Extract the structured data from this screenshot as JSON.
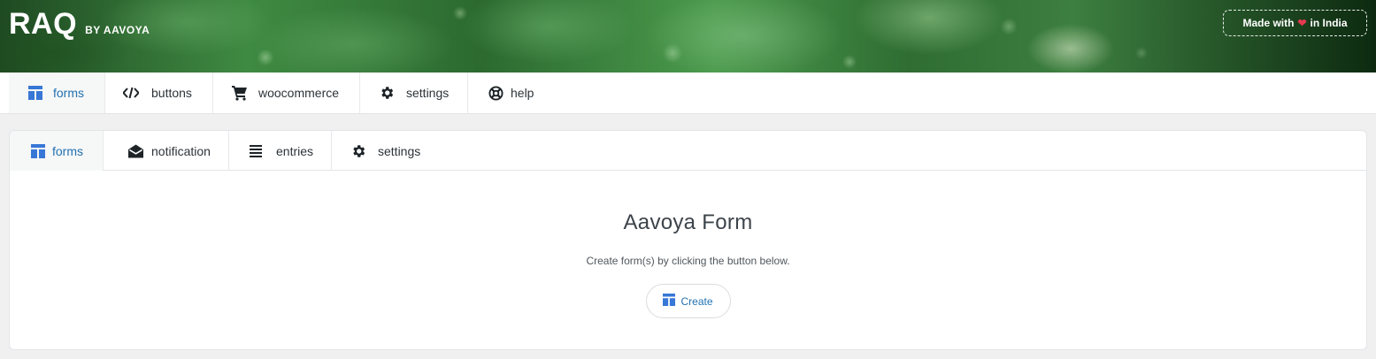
{
  "brand": {
    "name": "RAQ",
    "by": "BY AAVOYA",
    "badge_prefix": "Made with",
    "badge_suffix": "in India",
    "heart_color": "#e53950"
  },
  "topnav": {
    "items": [
      {
        "label": "forms",
        "icon": "forms-layout-icon",
        "active": true
      },
      {
        "label": "buttons",
        "icon": "code-icon",
        "active": false
      },
      {
        "label": "woocommerce",
        "icon": "cart-icon",
        "active": false
      },
      {
        "label": "settings",
        "icon": "gear-icon",
        "active": false
      },
      {
        "label": "help",
        "icon": "lifebuoy-icon",
        "active": false
      }
    ]
  },
  "subnav": {
    "items": [
      {
        "label": "forms",
        "icon": "forms-layout-icon",
        "active": true
      },
      {
        "label": "notification",
        "icon": "envelope-open-icon",
        "active": false
      },
      {
        "label": "entries",
        "icon": "list-icon",
        "active": false
      },
      {
        "label": "settings",
        "icon": "gear-icon",
        "active": false
      }
    ]
  },
  "empty_state": {
    "title": "Aavoya Form",
    "description": "Create form(s) by clicking the button below.",
    "button_label": "Create"
  },
  "colors": {
    "accent": "#2271b1",
    "icon_accent": "#3777d6"
  }
}
